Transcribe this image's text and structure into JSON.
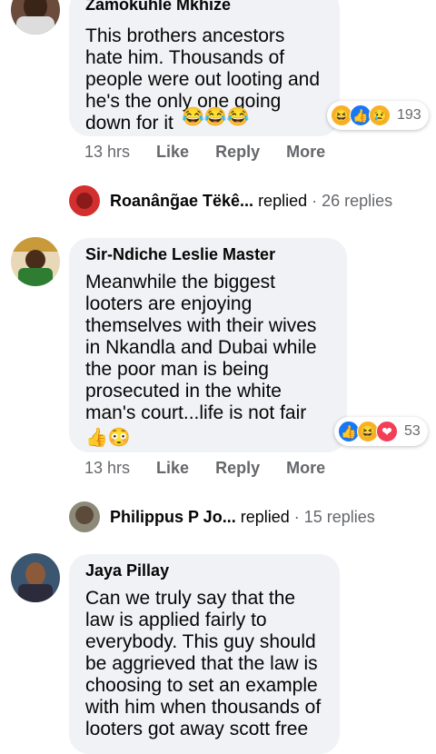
{
  "comments": [
    {
      "author": "Zamokuhle Mkhize",
      "text": "This brothers ancestors hate him. Thousands of people were out looting and he's the only one going down for it",
      "emojis": "😂😂😂",
      "reactions": [
        "😆",
        "👍",
        "😢"
      ],
      "reaction_count": "193",
      "time": "13 hrs",
      "actions": [
        "Like",
        "Reply",
        "More"
      ],
      "replied": {
        "name": "Roanâng̃ae Tëkê...",
        "verb": "replied",
        "count": "· 26 replies"
      }
    },
    {
      "author": "Sir-Ndiche Leslie Master",
      "text": "Meanwhile the biggest looters are enjoying themselves with their wives in Nkandla and Dubai while the poor man is being prosecuted in the white man's court...life is not fair",
      "emojis": "👍😳",
      "reactions": [
        "👍",
        "😆",
        "❤"
      ],
      "reaction_count": "53",
      "time": "13 hrs",
      "actions": [
        "Like",
        "Reply",
        "More"
      ],
      "replied": {
        "name": "Philippus P Jo...",
        "verb": "replied",
        "count": "· 15 replies"
      }
    },
    {
      "author": "Jaya Pillay",
      "text": "Can we truly say that the law is applied fairly to everybody. This guy should be aggrieved that the law is choosing to set an example with him when thousands of looters got away scott free",
      "emojis": ""
    }
  ]
}
